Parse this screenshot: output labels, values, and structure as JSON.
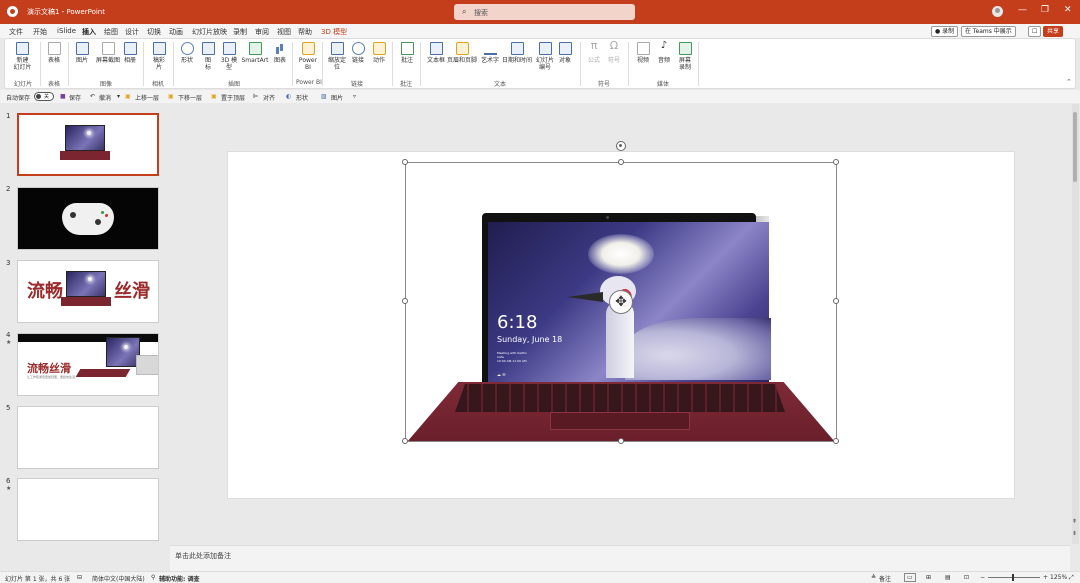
{
  "titlebar": {
    "document_title": "演示文稿1 - PowerPoint",
    "search_placeholder": "搜索",
    "minimize_glyph": "—",
    "restore_glyph": "❐",
    "close_glyph": "✕"
  },
  "menu": {
    "tabs": [
      "文件",
      "开始",
      "iSlide",
      "插入",
      "绘图",
      "设计",
      "切换",
      "动画",
      "幻灯片放映",
      "录制",
      "审阅",
      "视图",
      "帮助",
      "3D 模型"
    ],
    "active_tab": "插入",
    "record_button": "● 录制",
    "teams_button": "在 Teams 中展示",
    "share_button": "共享"
  },
  "ribbon": {
    "new_slide": "新建\n幻灯片",
    "table": "表格",
    "picture": "图片",
    "screenshot": "屏幕截图",
    "album": "相册",
    "gallery": "稿彩\n片",
    "shapes": "形状",
    "icons": "图\n标",
    "model3d": "3D 模\n型",
    "smartart": "SmartArt",
    "chart": "图表",
    "powerbi": "Power\nBI",
    "zoom": "缩放定\n位",
    "link": "链接",
    "action": "动作",
    "comment": "批注",
    "textbox": "文本框",
    "header_footer": "页眉和页脚",
    "wordart": "艺术字",
    "datetime": "日期和时间",
    "slide_number": "幻灯片\n编号",
    "object": "对象",
    "equation": "公式",
    "symbol": "符号",
    "video": "视频",
    "audio": "音频",
    "screen_record": "屏幕\n录制",
    "groups": {
      "slides": "幻灯片",
      "tables": "表格",
      "images": "图像",
      "camera": "相机",
      "illustrations": "插图",
      "powerbi": "Power BI",
      "links": "链接",
      "comments": "批注",
      "text": "文本",
      "symbols": "符号",
      "media": "媒体"
    }
  },
  "qat": {
    "autosave": "自动保存",
    "autosave_state": "关",
    "save": "保存",
    "undo": "撤消",
    "bring_forward": "上移一层",
    "send_backward": "下移一层",
    "bring_front": "置于顶层",
    "align": "对齐",
    "shape": "形状",
    "picture": "图片"
  },
  "thumbnails": [
    {
      "num": "1",
      "star": "",
      "title": ""
    },
    {
      "num": "2",
      "star": "",
      "title": ""
    },
    {
      "num": "3",
      "star": "",
      "title_left": "流畅",
      "title_right": "丝滑"
    },
    {
      "num": "4",
      "star": "★",
      "title": "流畅丝滑",
      "subtitle": "让工作和游戏更加轻便，便捷地生活"
    },
    {
      "num": "5",
      "star": "",
      "title": ""
    },
    {
      "num": "6",
      "star": "★",
      "title": ""
    }
  ],
  "slide": {
    "lockscreen_time": "6:18",
    "lockscreen_date": "Sunday, June 18",
    "lockscreen_meeting": "Meeting with Kaitlin\nCafe\n10:00 AM-11:00 AM",
    "lockscreen_icons": "☁ ✉"
  },
  "notes_placeholder": "单击此处添加备注",
  "status": {
    "slide_info": "幻灯片 第 1 张，共 6 张",
    "language": "简体中文(中国大陆)",
    "accessibility": "辅助功能: 调查",
    "notes": "备注",
    "zoom_value": "125%"
  },
  "colors": {
    "brand": "#c43e1c",
    "slide_title_red": "#9c2a2a"
  }
}
